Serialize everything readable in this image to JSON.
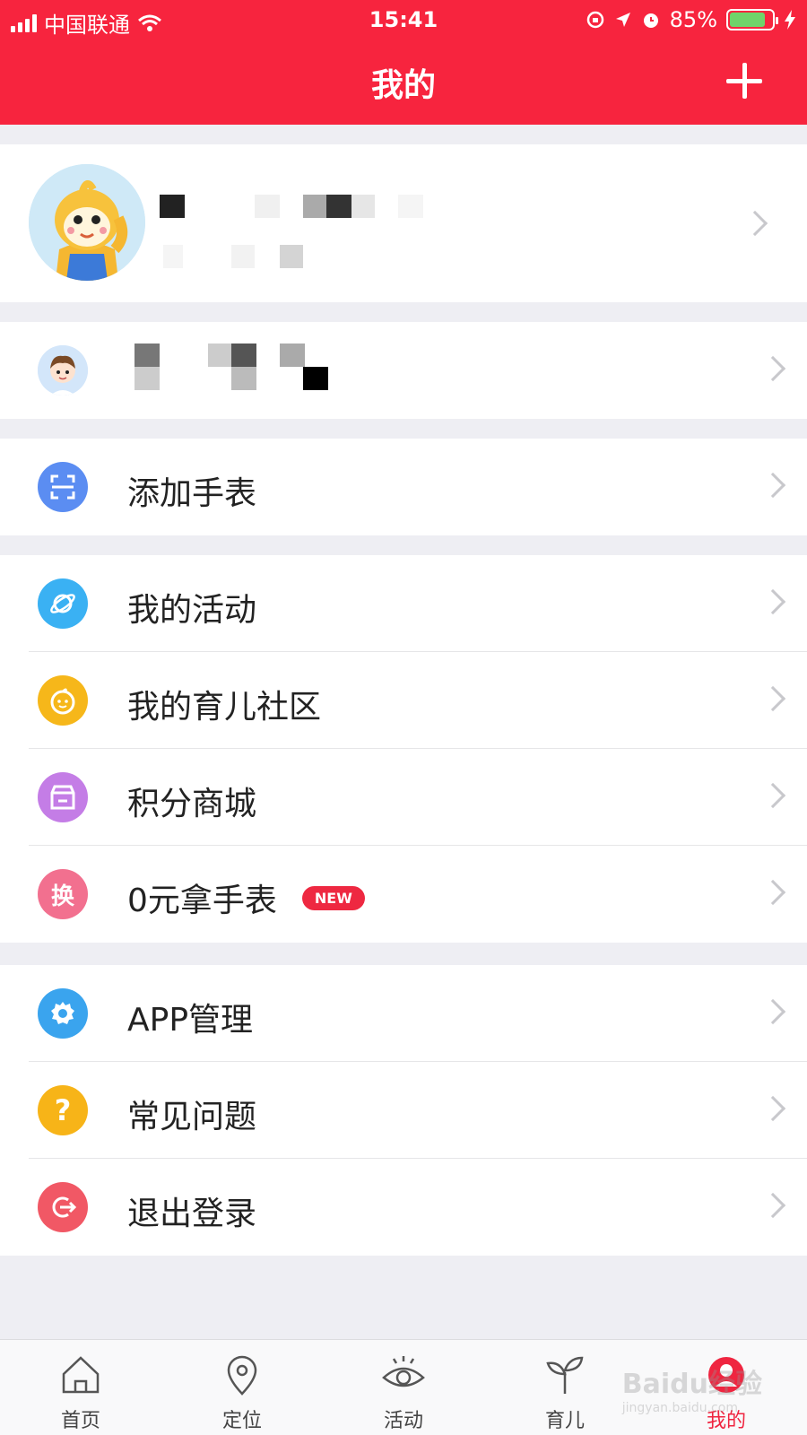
{
  "status": {
    "carrier": "中国联通",
    "time": "15:41",
    "battery": "85%",
    "battery_level": 0.85
  },
  "header": {
    "title": "我的"
  },
  "device": {},
  "menu_group_1": [
    {
      "label": "添加手表",
      "icon": "scan-icon",
      "color": "#5b8df2"
    }
  ],
  "menu_group_2": [
    {
      "label": "我的活动",
      "icon": "planet-icon",
      "color": "#3ab1f3"
    },
    {
      "label": "我的育儿社区",
      "icon": "baby-face-icon",
      "color": "#f6b71a"
    },
    {
      "label": "积分商城",
      "icon": "store-icon",
      "color": "#c47de6"
    },
    {
      "label": "0元拿手表",
      "icon": "exchange-icon",
      "icon_text": "换",
      "color": "#f2708f",
      "badge": "NEW"
    }
  ],
  "menu_group_3": [
    {
      "label": "APP管理",
      "icon": "gear-icon",
      "color": "#3aa4ee"
    },
    {
      "label": "常见问题",
      "icon": "question-icon",
      "icon_text": "?",
      "color": "#f7b418"
    },
    {
      "label": "退出登录",
      "icon": "logout-icon",
      "color": "#f15865"
    }
  ],
  "tabbar": {
    "items": [
      {
        "label": "首页",
        "icon": "home-icon"
      },
      {
        "label": "定位",
        "icon": "location-pin-icon"
      },
      {
        "label": "活动",
        "icon": "eye-icon"
      },
      {
        "label": "育儿",
        "icon": "sprout-icon"
      },
      {
        "label": "我的",
        "icon": "profile-icon",
        "active": true
      }
    ]
  },
  "watermark": {
    "text": "Baidu经验",
    "sub": "jingyan.baidu.com"
  }
}
